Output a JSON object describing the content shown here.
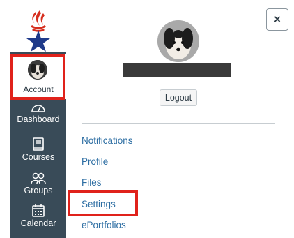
{
  "tray": {
    "close_glyph": "×",
    "logout_label": "Logout",
    "links": [
      "Notifications",
      "Profile",
      "Files",
      "Settings",
      "ePortfolios"
    ]
  },
  "sidebar": {
    "account_label": "Account",
    "items": [
      {
        "label": "Dashboard",
        "icon": "dashboard-icon"
      },
      {
        "label": "Courses",
        "icon": "courses-icon"
      },
      {
        "label": "Groups",
        "icon": "groups-icon"
      },
      {
        "label": "Calendar",
        "icon": "calendar-icon"
      }
    ]
  },
  "colors": {
    "sidebar_bg": "#394b58",
    "highlight": "#e0221b",
    "link": "#2d6ea3",
    "logo_red": "#d62e1e",
    "logo_blue": "#1f3a8a"
  }
}
